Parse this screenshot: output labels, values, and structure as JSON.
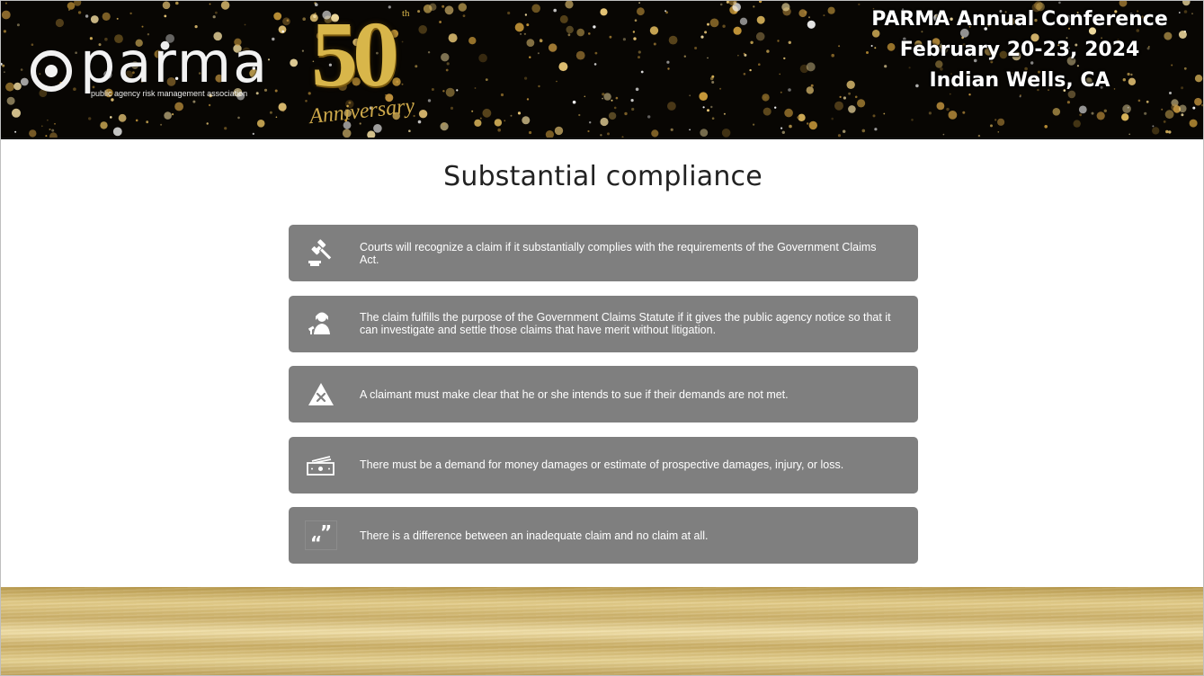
{
  "header": {
    "logo_text": "parma",
    "logo_subtitle": "public agency risk management association",
    "anniversary_number": "50",
    "anniversary_suffix": "th",
    "anniversary_word": "Anniversary",
    "conference_lines": [
      "PARMA Annual Conference",
      "February 20-23, 2024",
      "Indian Wells, CA"
    ]
  },
  "slide": {
    "title": "Substantial compliance",
    "items": [
      {
        "icon": "gavel-icon",
        "text": "Courts will recognize a claim if it substantially complies with the requirements of the Government Claims Act."
      },
      {
        "icon": "judge-icon",
        "text": "The claim fulfills the purpose of the Government Claims Statute if it gives the public agency notice so that it can investigate and settle those claims that have merit without litigation."
      },
      {
        "icon": "warning-x-icon",
        "text": "A claimant must make clear that he or she intends to sue if their demands are not met."
      },
      {
        "icon": "money-icon",
        "text": "There must be a demand for money damages or estimate of prospective damages, injury, or loss."
      },
      {
        "icon": "quote-icon",
        "text": "There is a difference between an inadequate claim and no claim at all."
      }
    ]
  },
  "colors": {
    "item_background": "#7f7f7f",
    "banner_background": "#080603",
    "gold": "#d8b64a"
  }
}
